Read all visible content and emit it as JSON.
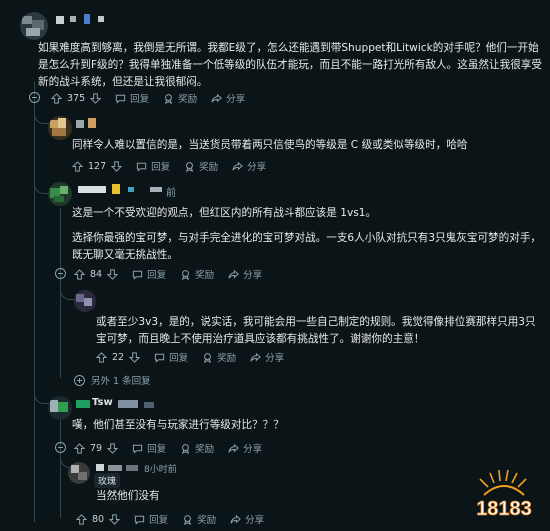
{
  "comments": [
    {
      "id": "c1",
      "username": "",
      "text": "如果难度高到够离，我倒是无所谓。我都E级了，怎么还能遇到带Shuppet和Litwick的对手呢？他们一开始是怎么升到F级的？我得单独准备一个低等级的队伍才能玩，而且不能一路打光所有敌人。这虽然让我很享受新的战斗系统，但还是让我很郁闷。",
      "upvotes": "375",
      "reply": "回复",
      "award": "奖励",
      "share": "分享"
    },
    {
      "id": "c2",
      "username": "",
      "text": "同样令人难以置信的是，当送货员带着两只信使鸟的等级是 C 级或类似等级时，哈哈",
      "upvotes": "127",
      "reply": "回复",
      "award": "奖励",
      "share": "分享"
    },
    {
      "id": "c3",
      "username": "",
      "time": "前",
      "text1": "这是一个不受欢迎的观点，但红区内的所有战斗都应该是 1vs1。",
      "text2": "选择你最强的宝可梦，与对手完全进化的宝可梦对战。一支6人小队对抗只有3只鬼灰宝可梦的对手，既无聊又毫无挑战性。",
      "upvotes": "84",
      "reply": "回复",
      "award": "奖励",
      "share": "分享"
    },
    {
      "id": "c4",
      "username": "",
      "text": "或者至少3v3，是的，说实话，我可能会用一些自己制定的规则。我觉得像排位赛那样只用3只宝可梦，而且晚上不使用治疗道具应该都有挑战性了。谢谢你的主意！",
      "upvotes": "22",
      "reply": "回复",
      "award": "奖励",
      "share": "分享"
    },
    {
      "id": "c5",
      "username": "Tsw",
      "text": "嘆，他们甚至没有与玩家进行等级对比？？？",
      "upvotes": "79",
      "reply": "回复",
      "award": "奖励",
      "share": "分享"
    },
    {
      "id": "c6",
      "username": "",
      "time": "8小时前",
      "tooltip": "玫瑰",
      "text": "当然他们没有",
      "upvotes": "80",
      "reply": "回复",
      "award": "奖励",
      "share": "分享"
    }
  ],
  "more_replies": "另外 1 条回复",
  "watermark": "18183",
  "colors": {
    "background": "#0b1416",
    "thread_line": "#33464c",
    "muted": "#8ba2ad",
    "text": "#e8eaed",
    "watermark": "#f0a020"
  }
}
